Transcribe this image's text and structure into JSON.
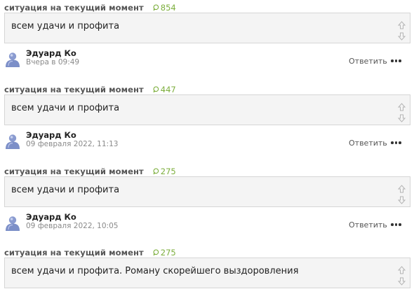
{
  "posts": [
    {
      "topic": "ситуация на текущий момент",
      "count": "854",
      "text": "всем удачи и профита",
      "author": "Эдуард Ко",
      "time": "Вчера в 09:49",
      "reply_label": "Ответить"
    },
    {
      "topic": "ситуация на текущий момент",
      "count": "447",
      "text": "всем удачи и профита",
      "author": "Эдуард Ко",
      "time": "09 февраля 2022, 11:13",
      "reply_label": "Ответить"
    },
    {
      "topic": "ситуация на текущий момент",
      "count": "275",
      "text": "всем удачи и профита",
      "author": "Эдуард Ко",
      "time": "09 февраля 2022, 10:05",
      "reply_label": "Ответить"
    },
    {
      "topic": "ситуация на текущий момент",
      "count": "275",
      "text": "всем удачи и профита. Роману скорейшего выздоровления"
    }
  ],
  "icons": {
    "comment": "comment-bubble-icon",
    "vote_up": "arrow-up-icon",
    "vote_down": "arrow-down-icon",
    "avatar": "user-avatar-icon",
    "more": "more-dots-icon"
  },
  "colors": {
    "count_green": "#7cae3c",
    "box_bg": "#f4f4f4",
    "box_border": "#d6d6d6",
    "avatar_blue": "#7c8fc8"
  }
}
